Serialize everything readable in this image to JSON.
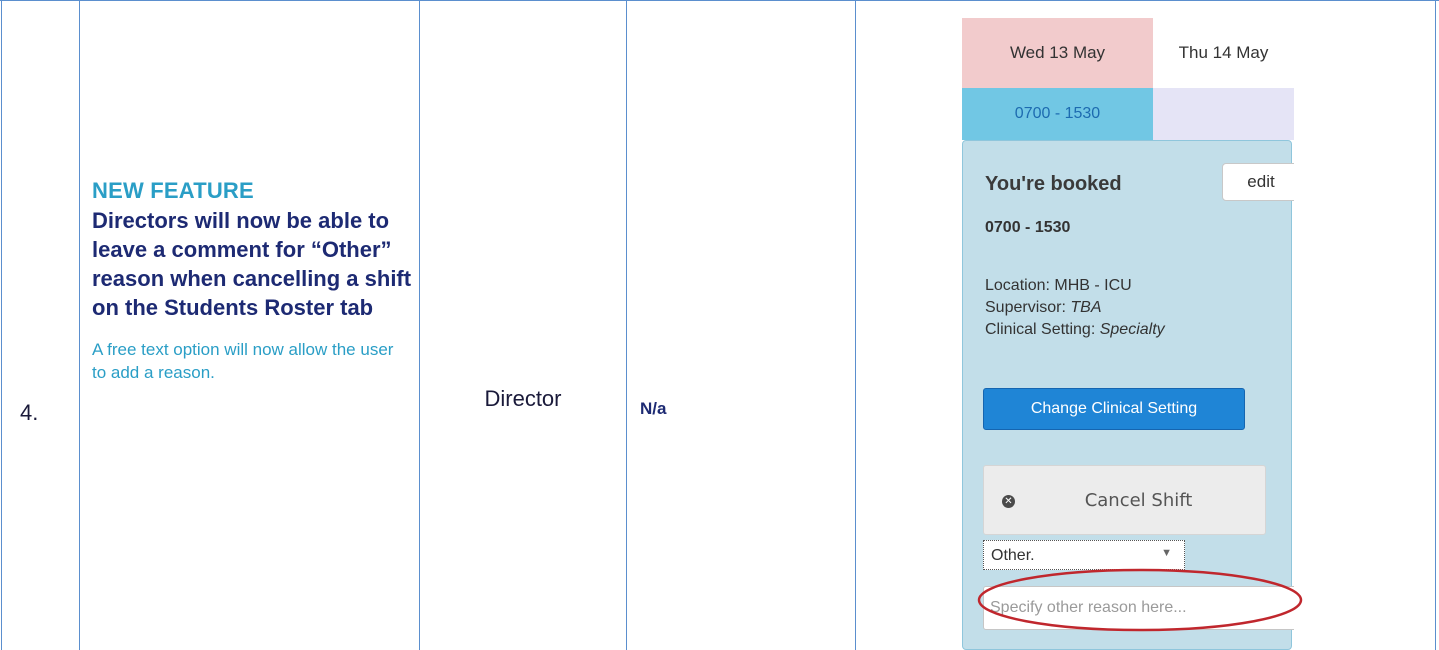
{
  "row": {
    "number": "4.",
    "feature_tag": "NEW FEATURE",
    "feature_title": "Directors will now be able to leave a comment for “Other” reason when cancelling a shift on the Students Roster tab",
    "feature_description": "A free text option will now allow the user to add a reason.",
    "role": "Director",
    "notes": "N/a"
  },
  "screenshot": {
    "days": [
      "Wed 13 May",
      "Thu 14 May"
    ],
    "booked_slot": "0700 - 1530",
    "popover": {
      "title": "You're booked",
      "edit_label": "edit",
      "time": "0700 - 1530",
      "location_label": "Location:",
      "location_value": "MHB - ICU",
      "supervisor_label": "Supervisor:",
      "supervisor_value": "TBA",
      "clinical_setting_label": "Clinical Setting:",
      "clinical_setting_value": "Specialty",
      "change_button": "Change Clinical Setting",
      "cancel_button": "Cancel Shift",
      "reason_selected": "Other.",
      "reason_placeholder": "Specify other reason here..."
    }
  },
  "colors": {
    "grid_line": "#5b8fce",
    "feature_tag": "#2a9ec6",
    "feature_title": "#1d2a73",
    "wed_header": "#f2cbcc",
    "booked_slot": "#71c7e4",
    "popover_bg": "#c2dee9",
    "primary_button": "#1f85d6",
    "highlight": "#c0272d"
  },
  "icons": {
    "cancel": "times-circle-icon",
    "dropdown": "caret-down-icon"
  }
}
